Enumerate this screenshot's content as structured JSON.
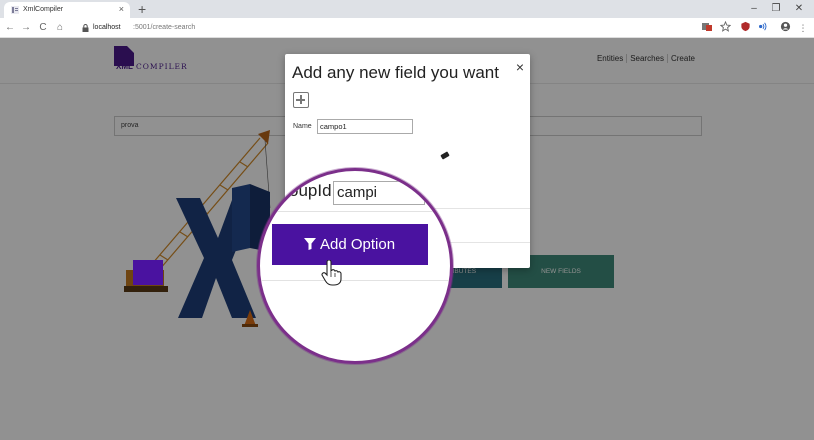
{
  "browser": {
    "tab_title": "XmlCompiler",
    "tab_close": "×",
    "new_tab": "+",
    "url_host": "localhost",
    "url_path": ":5001/create-search",
    "window": {
      "minimize": "–",
      "maximize": "❐",
      "close": "✕"
    },
    "nav": {
      "back": "←",
      "forward": "→",
      "reload": "C",
      "home": "⌂"
    },
    "menu": "⋮"
  },
  "app": {
    "logo_xml": "XML",
    "logo_compiler": "COMPILER",
    "nav": [
      "Entities",
      "Searches",
      "Create"
    ],
    "search_value": "prova",
    "tiles": [
      {
        "label": "TRIBUTES",
        "color": "#2a6f7f"
      },
      {
        "label": "NEW FIELDS",
        "color": "#3f8a7a"
      }
    ]
  },
  "modal": {
    "title": "Add any new field you want",
    "close": "×",
    "name_label": "Name",
    "name_value": "campo1"
  },
  "magnifier": {
    "group_label": "oupId",
    "group_value": "campi",
    "add_option_label": "Add Option"
  },
  "colors": {
    "accent": "#4a12a0",
    "magnifier_ring": "#7b2f8a",
    "logo": "#4a1a8c"
  }
}
